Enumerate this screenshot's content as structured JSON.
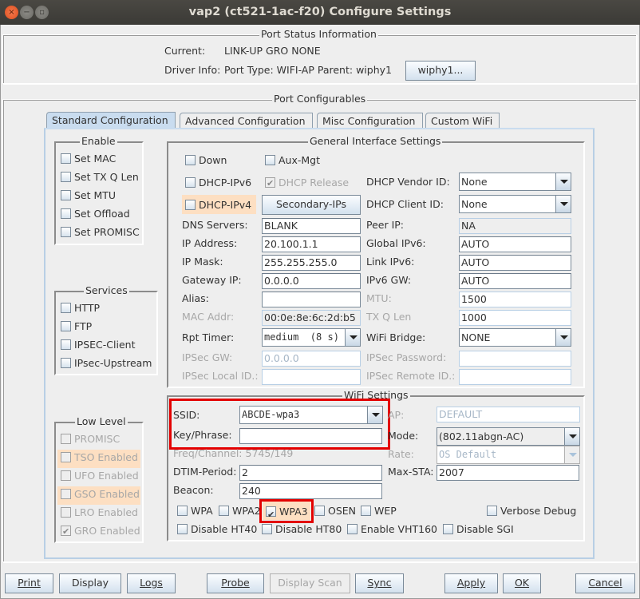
{
  "window": {
    "title": "vap2  (ct521-1ac-f20) Configure Settings",
    "controls": {
      "close": "×",
      "minimize": "−",
      "maximize": "□"
    }
  },
  "port_status": {
    "title": "Port Status Information",
    "current_label": "Current:",
    "current_value": "LINK-UP GRO  NONE",
    "driver_label": "Driver Info:",
    "driver_value": "Port Type: WIFI-AP   Parent: wiphy1",
    "parent_button": "wiphy1..."
  },
  "configurables": {
    "title": "Port Configurables",
    "tabs": [
      {
        "label": "Standard Configuration",
        "active": true
      },
      {
        "label": "Advanced Configuration",
        "active": false
      },
      {
        "label": "Misc Configuration",
        "active": false
      },
      {
        "label": "Custom WiFi",
        "active": false
      }
    ]
  },
  "enable": {
    "title": "Enable",
    "items": [
      {
        "label": "Set MAC",
        "checked": false
      },
      {
        "label": "Set TX Q Len",
        "checked": false
      },
      {
        "label": "Set MTU",
        "checked": false
      },
      {
        "label": "Set Offload",
        "checked": false
      },
      {
        "label": "Set PROMISC",
        "checked": false
      }
    ]
  },
  "services": {
    "title": "Services",
    "items": [
      {
        "label": "HTTP",
        "checked": false
      },
      {
        "label": "FTP",
        "checked": false
      },
      {
        "label": "IPSEC-Client",
        "checked": false
      },
      {
        "label": "IPsec-Upstream",
        "checked": false
      }
    ]
  },
  "low_level": {
    "title": "Low Level",
    "items": [
      {
        "label": "PROMISC",
        "checked": false,
        "highlight": false
      },
      {
        "label": "TSO Enabled",
        "checked": false,
        "highlight": true
      },
      {
        "label": "UFO Enabled",
        "checked": false,
        "highlight": false
      },
      {
        "label": "GSO Enabled",
        "checked": false,
        "highlight": true
      },
      {
        "label": "LRO Enabled",
        "checked": false,
        "highlight": false
      },
      {
        "label": "GRO Enabled",
        "checked": true,
        "highlight": false
      }
    ]
  },
  "general": {
    "title": "General Interface Settings",
    "down": "Down",
    "aux_mgt": "Aux-Mgt",
    "dhcp_ipv6": "DHCP-IPv6",
    "dhcp_release": "DHCP Release",
    "dhcp_ipv4": "DHCP-IPv4",
    "secondary_ips": "Secondary-IPs",
    "dhcp_vendor_label": "DHCP Vendor ID:",
    "dhcp_vendor_value": "None",
    "dhcp_client_label": "DHCP Client ID:",
    "dhcp_client_value": "None",
    "dns_label": "DNS Servers:",
    "dns_value": "BLANK",
    "peer_ip_label": "Peer IP:",
    "peer_ip_value": "NA",
    "ip_label": "IP Address:",
    "ip_value": "20.100.1.1",
    "global_ipv6_label": "Global IPv6:",
    "global_ipv6_value": "AUTO",
    "mask_label": "IP Mask:",
    "mask_value": "255.255.255.0",
    "link_ipv6_label": "Link IPv6:",
    "link_ipv6_value": "AUTO",
    "gateway_label": "Gateway IP:",
    "gateway_value": "0.0.0.0",
    "ipv6_gw_label": "IPv6 GW:",
    "ipv6_gw_value": "AUTO",
    "alias_label": "Alias:",
    "alias_value": "",
    "mtu_label": "MTU:",
    "mtu_value": "1500",
    "mac_label": "MAC Addr:",
    "mac_value": "00:0e:8e:6c:2d:b5",
    "txq_label": "TX Q Len",
    "txq_value": "1000",
    "rpt_label": "Rpt Timer:",
    "rpt_value": "medium  (8 s)",
    "bridge_label": "WiFi Bridge:",
    "bridge_value": "NONE",
    "ipsec_gw_label": "IPSec GW:",
    "ipsec_gw_value": "0.0.0.0",
    "ipsec_pw_label": "IPSec Password:",
    "ipsec_pw_value": "",
    "ipsec_local_label": "IPSec Local ID.:",
    "ipsec_local_value": "",
    "ipsec_remote_label": "IPSec Remote ID.:",
    "ipsec_remote_value": ""
  },
  "wifi": {
    "title": "WiFi Settings",
    "ssid_label": "SSID:",
    "ssid_value": "ABCDE-wpa3",
    "ap_label": "AP:",
    "ap_value": "DEFAULT",
    "key_label": "Key/Phrase:",
    "key_value": "",
    "mode_label": "Mode:",
    "mode_value": "(802.11abgn-AC)",
    "freq_label": "Freq/Channel: 5745/149",
    "rate_label": "Rate:",
    "rate_value": "OS Default",
    "dtim_label": "DTIM-Period:",
    "dtim_value": "2",
    "maxsta_label": "Max-STA:",
    "maxsta_value": "2007",
    "beacon_label": "Beacon:",
    "beacon_value": "240",
    "checks1": [
      {
        "label": "WPA",
        "checked": false
      },
      {
        "label": "WPA2",
        "checked": false
      },
      {
        "label": "WPA3",
        "checked": true
      },
      {
        "label": "OSEN",
        "checked": false
      },
      {
        "label": "WEP",
        "checked": false
      }
    ],
    "verbose_debug": "Verbose Debug",
    "checks2": [
      {
        "label": "Disable HT40",
        "checked": false
      },
      {
        "label": "Disable HT80",
        "checked": false
      },
      {
        "label": "Enable VHT160",
        "checked": false
      },
      {
        "label": "Disable SGI",
        "checked": false
      }
    ]
  },
  "footer": {
    "print": "Print",
    "display": "Display",
    "logs": "Logs",
    "probe": "Probe",
    "display_scan": "Display Scan",
    "sync": "Sync",
    "apply": "Apply",
    "ok": "OK",
    "cancel": "Cancel"
  },
  "colors": {
    "highlight": "#fddfc2",
    "annotation_red": "#e30000",
    "active_tab": "#c9dcef"
  }
}
